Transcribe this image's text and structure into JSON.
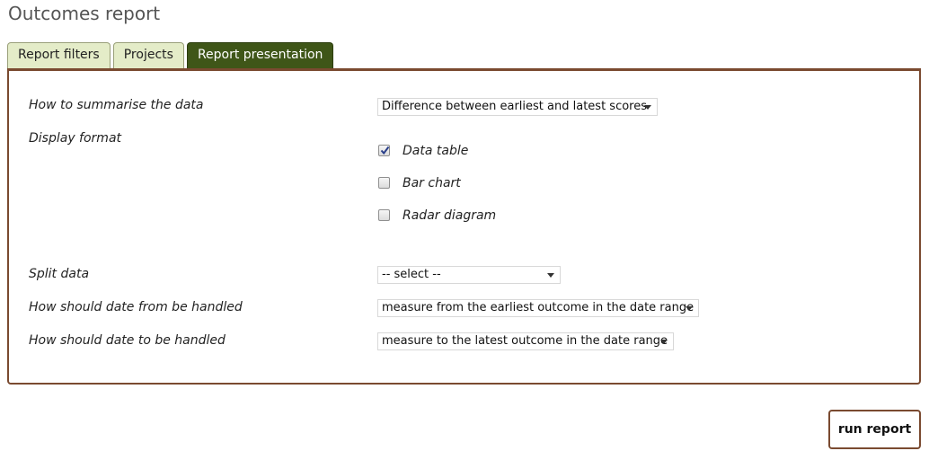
{
  "page": {
    "title": "Outcomes report"
  },
  "tabs": [
    {
      "label": "Report filters",
      "active": false
    },
    {
      "label": "Projects",
      "active": false
    },
    {
      "label": "Report presentation",
      "active": true
    }
  ],
  "form": {
    "summarise": {
      "label": "How to summarise the data",
      "value": "Difference between earliest and latest scores"
    },
    "display_format": {
      "label": "Display format",
      "options": [
        {
          "label": "Data table",
          "checked": true
        },
        {
          "label": "Bar chart",
          "checked": false
        },
        {
          "label": "Radar diagram",
          "checked": false
        }
      ]
    },
    "split": {
      "label": "Split data",
      "value": "-- select --"
    },
    "date_from": {
      "label": "How should date from be handled",
      "value": "measure from the earliest outcome in the date range"
    },
    "date_to": {
      "label": "How should date to be handled",
      "value": "measure to the latest outcome in the date range"
    }
  },
  "actions": {
    "run_label": "run report"
  },
  "colors": {
    "active_tab": "#3f5618",
    "inactive_tab": "#e4ecc8",
    "panel_border": "#7a4a30"
  }
}
